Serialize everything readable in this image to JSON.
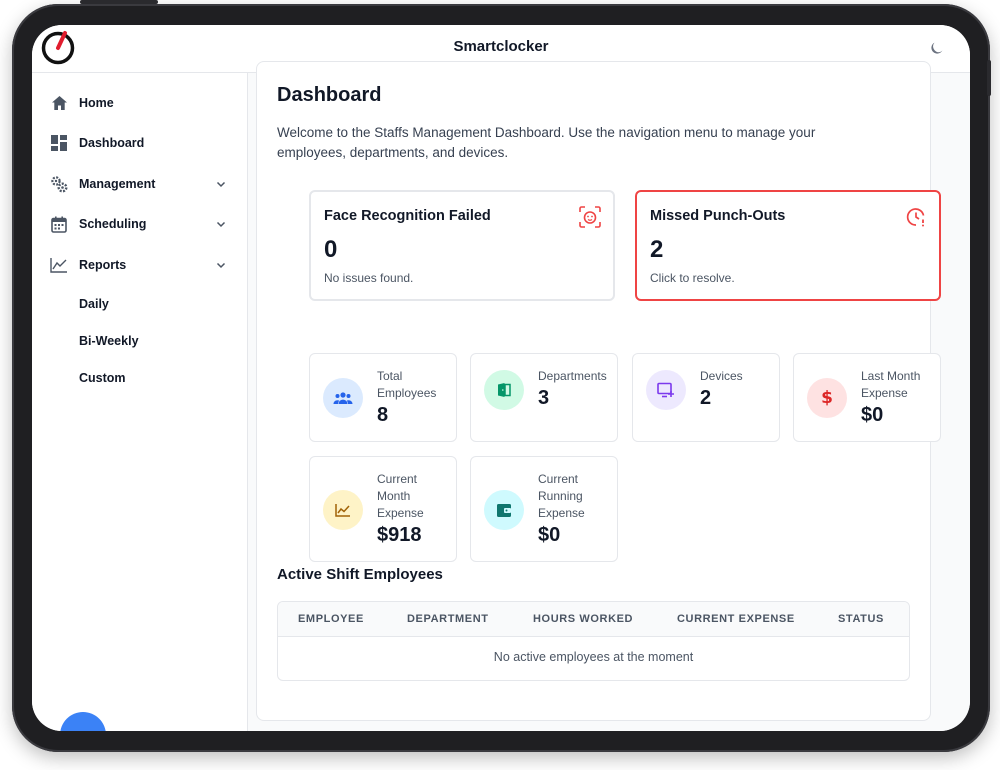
{
  "app": {
    "title": "Smartclocker"
  },
  "sidebar": {
    "items": [
      {
        "label": "Home",
        "icon": "home-icon"
      },
      {
        "label": "Dashboard",
        "icon": "dashboard-icon"
      },
      {
        "label": "Management",
        "icon": "gears-icon"
      },
      {
        "label": "Scheduling",
        "icon": "calendar-icon"
      },
      {
        "label": "Reports",
        "icon": "line-chart-icon"
      }
    ],
    "report_subitems": [
      "Daily",
      "Bi-Weekly",
      "Custom"
    ]
  },
  "page": {
    "title": "Dashboard",
    "welcome": "Welcome to the Staffs Management Dashboard. Use the navigation menu to manage your employees, departments, and devices."
  },
  "alerts": [
    {
      "title": "Face Recognition Failed",
      "value": "0",
      "subtitle": "No issues found.",
      "icon": "face-scan-icon",
      "color": "#ef4444"
    },
    {
      "title": "Missed Punch-Outs",
      "value": "2",
      "subtitle": "Click to resolve.",
      "icon": "clock-alert-icon",
      "color": "#ef4444"
    }
  ],
  "stats": [
    {
      "label_lines": [
        "Total",
        "Employees"
      ],
      "value": "8",
      "icon": "users-icon",
      "circle_color": "#dbeafe",
      "icon_color": "#2563eb"
    },
    {
      "label_lines": [
        "Departments"
      ],
      "value": "3",
      "icon": "door-icon",
      "circle_color": "#d1fae5",
      "icon_color": "#059669"
    },
    {
      "label_lines": [
        "Devices"
      ],
      "value": "2",
      "icon": "device-add-icon",
      "circle_color": "#ede9fe",
      "icon_color": "#7c3aed"
    },
    {
      "label_lines": [
        "Last Month",
        "Expense"
      ],
      "value": "$0",
      "icon": "dollar-icon",
      "circle_color": "#fee2e2",
      "icon_color": "#dc2626"
    },
    {
      "label_lines": [
        "Current",
        "Month",
        "Expense"
      ],
      "value": "$918",
      "icon": "trend-chart-icon",
      "circle_color": "#fef3c7",
      "icon_color": "#a16207"
    },
    {
      "label_lines": [
        "Current",
        "Running",
        "Expense"
      ],
      "value": "$0",
      "icon": "wallet-icon",
      "circle_color": "#cffafe",
      "icon_color": "#0f766e"
    }
  ],
  "active_shift": {
    "title": "Active Shift Employees",
    "columns": [
      "EMPLOYEE",
      "DEPARTMENT",
      "HOURS WORKED",
      "CURRENT EXPENSE",
      "STATUS"
    ],
    "empty_message": "No active employees at the moment"
  }
}
